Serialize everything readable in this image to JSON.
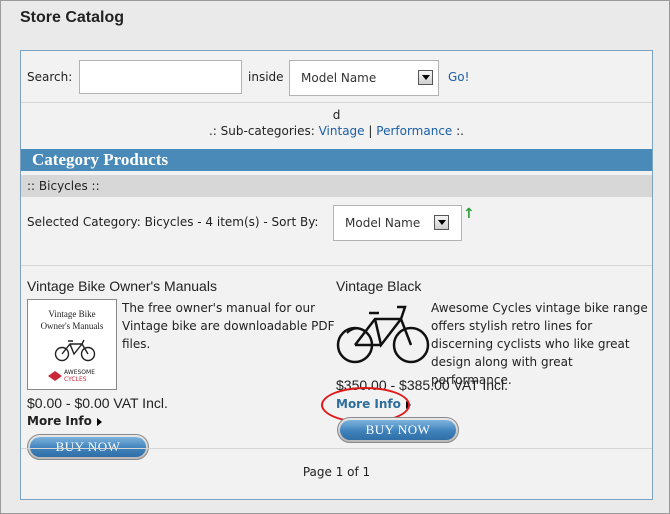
{
  "page": {
    "title": "Store Catalog"
  },
  "search": {
    "label": "Search:",
    "value": "",
    "inside_label": "inside",
    "field_select": "Model Name",
    "go_label": "Go!"
  },
  "subcategories": {
    "description": "d",
    "prefix": ".: Sub-categories:",
    "items": [
      "Vintage",
      "Performance"
    ],
    "separator": "|",
    "suffix": ":."
  },
  "category_header": "Category Products",
  "breadcrumb": ":: Bicycles ::",
  "sort": {
    "summary": "Selected Category: Bicycles - 4 item(s) - Sort By:",
    "selected": "Model Name",
    "direction_icon": "green-up-arrow"
  },
  "products": [
    {
      "name": "Vintage Bike Owner's Manuals",
      "image_text": [
        "Vintage Bike",
        "Owner's Manuals"
      ],
      "image_logo_text": [
        "AWESOME",
        "CYCLES"
      ],
      "description": "The free owner's manual for our Vintage bike are downloadable PDF files.",
      "price": "$0.00 - $0.00 VAT Incl.",
      "more_info": "More Info",
      "buy_label": "BUY NOW"
    },
    {
      "name": "Vintage Black",
      "description": "Awesome Cycles vintage bike range offers stylish retro lines for discerning cyclists who like great design along with great performance.",
      "price": "$350.00 - $385.00 VAT Incl.",
      "more_info": "More Info",
      "buy_label": "BUY NOW"
    }
  ],
  "pagination": "Page 1 of 1",
  "colors": {
    "category_bar": "#4a8ab8",
    "link": "#1a5fa8",
    "highlight_ellipse": "#e01818",
    "sort_arrow": "#2e9e3c"
  }
}
